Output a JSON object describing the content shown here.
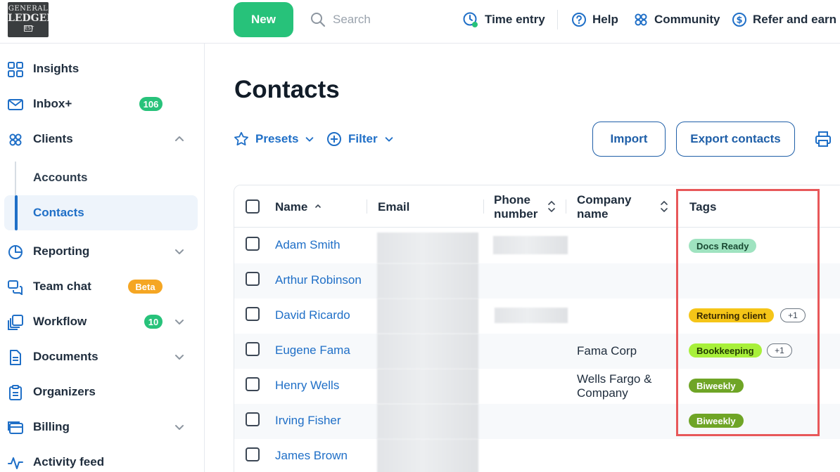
{
  "logo": {
    "line1": "GENERAL",
    "line2": "LEDGER",
    "mark": "EST"
  },
  "topbar": {
    "new_label": "New",
    "search_placeholder": "Search",
    "time_entry": "Time entry",
    "help": "Help",
    "community": "Community",
    "refer": "Refer and earn"
  },
  "sidebar": {
    "insights": "Insights",
    "inbox": "Inbox+",
    "inbox_count": "106",
    "clients": "Clients",
    "accounts": "Accounts",
    "contacts": "Contacts",
    "reporting": "Reporting",
    "team_chat": "Team chat",
    "team_chat_badge": "Beta",
    "workflow": "Workflow",
    "workflow_count": "10",
    "documents": "Documents",
    "organizers": "Organizers",
    "billing": "Billing",
    "activity": "Activity feed"
  },
  "page": {
    "title": "Contacts",
    "presets": "Presets",
    "filter": "Filter",
    "import": "Import",
    "export": "Export contacts"
  },
  "table": {
    "headers": {
      "name": "Name",
      "email": "Email",
      "phone1": "Phone",
      "phone2": "number",
      "company1": "Company",
      "company2": "name",
      "tags": "Tags"
    },
    "rows": [
      {
        "name": "Adam Smith",
        "company": "",
        "company2": "",
        "tag": "Docs Ready",
        "more": ""
      },
      {
        "name": "Arthur Robinson",
        "company": "",
        "company2": "",
        "tag": "",
        "more": ""
      },
      {
        "name": "David Ricardo",
        "company": "",
        "company2": "",
        "tag": "Returning client",
        "more": "+1"
      },
      {
        "name": "Eugene Fama",
        "company": "Fama Corp",
        "company2": "",
        "tag": "Bookkeeping",
        "more": "+1"
      },
      {
        "name": "Henry Wells",
        "company": "Wells Fargo &",
        "company2": "Company",
        "tag": "Biweekly",
        "more": ""
      },
      {
        "name": "Irving Fisher",
        "company": "",
        "company2": "",
        "tag": "Biweekly",
        "more": ""
      },
      {
        "name": "James Brown",
        "company": "",
        "company2": "",
        "tag": "",
        "more": ""
      }
    ]
  },
  "colors": {
    "primary": "#1f6fc7",
    "new_button": "#27c27a",
    "tag_docs_ready": "#9fe3c0",
    "tag_returning": "#f5c518",
    "tag_bookkeeping": "#a8f03a",
    "tag_biweekly": "#6fa526",
    "highlight": "#e8585a"
  }
}
